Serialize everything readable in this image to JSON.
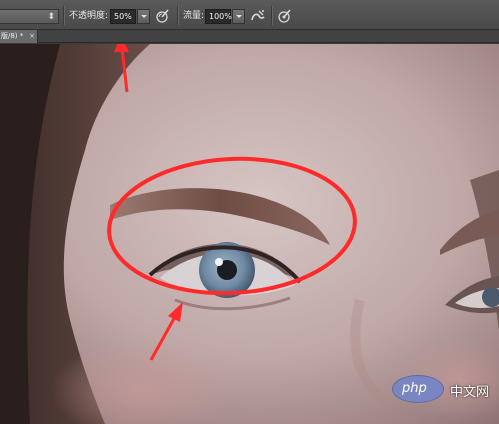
{
  "options_bar": {
    "opacity_label": "不透明度:",
    "opacity_value": "50%",
    "flow_label": "流量:",
    "flow_value": "100%"
  },
  "document_tab": {
    "title": "版/8) *",
    "close_glyph": "×"
  },
  "watermark": {
    "logo_text": "php",
    "site_text": "中文网"
  },
  "colors": {
    "annotation_red": "#ff2a2a",
    "toolbar_bg": "#535353"
  },
  "icons": [
    "pressure-opacity-icon",
    "airbrush-icon",
    "pressure-size-icon"
  ]
}
